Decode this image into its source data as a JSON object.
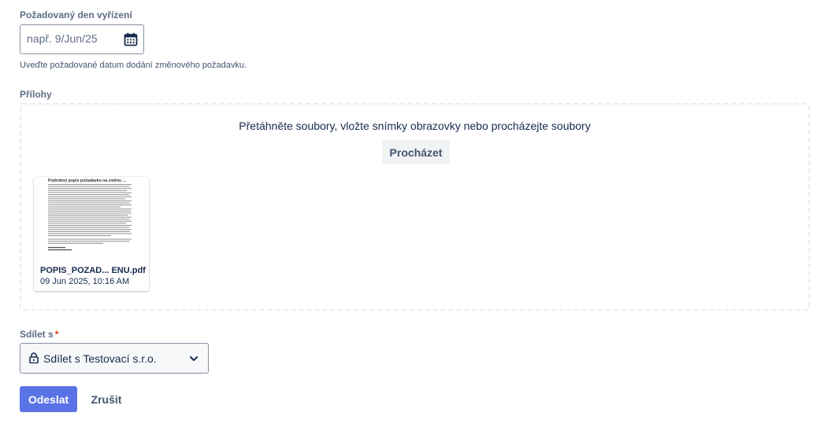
{
  "due_date": {
    "label": "Požadovaný den vyřízení",
    "placeholder": "např. 9/Jun/25",
    "value": "",
    "icon": "calendar-icon",
    "helper": "Uveďte požadované datum dodání změnového požadavku."
  },
  "attachments": {
    "label": "Přílohy",
    "drop_text": "Přetáhněte soubory, vložte snímky obrazovky nebo procházejte soubory",
    "browse_label": "Procházet",
    "files": [
      {
        "name": "POPIS_POZAD... ENU.pdf",
        "date": "09 Jun 2025, 10:16 AM",
        "preview_heading": "Podrobný popis požadavku na změnu ..."
      }
    ]
  },
  "share": {
    "label": "Sdílet s",
    "required_mark": "*",
    "value": "Sdílet s Testovací s.r.o.",
    "lock_icon": "lock-icon",
    "chevron_icon": "chevron-down-icon"
  },
  "actions": {
    "submit_label": "Odeslat",
    "cancel_label": "Zrušit"
  },
  "colors": {
    "primary": "#5973e6",
    "required": "#de350b",
    "label": "#5e6c84",
    "text": "#172b4d"
  }
}
